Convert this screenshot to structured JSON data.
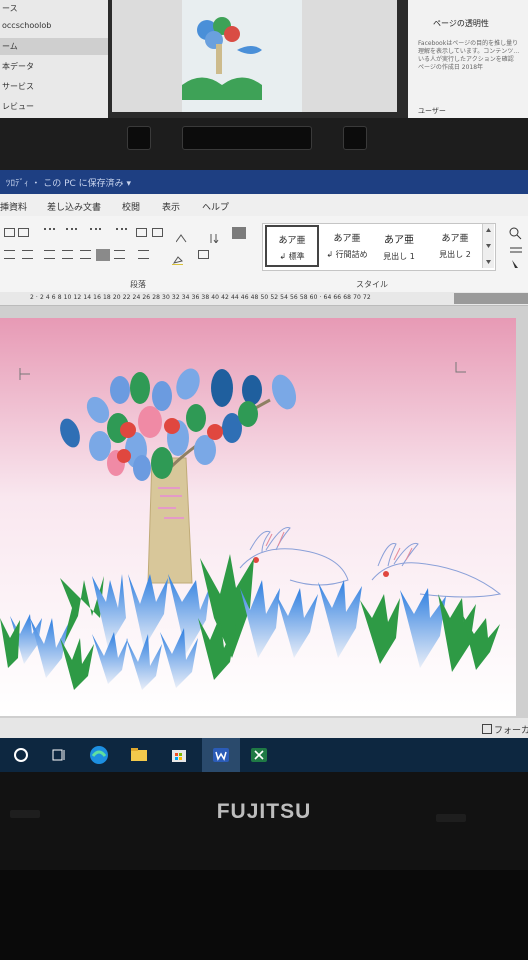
{
  "background_monitor": {
    "left_panel_items": [
      "ース",
      "occschoolob",
      "ーム",
      "本データ",
      "サービス",
      "レビュー"
    ],
    "facebook_title": "ページの透明性",
    "facebook_desc": "Facebookはページの目的を推し量り理解を表示しています。コンテンツ…いる人が実行したアクションを確認",
    "facebook_date": "ページの作成日 2018年",
    "facebook_user": "ユーザー"
  },
  "word": {
    "title": "ﾂﾛﾃﾞｨ ・ この PC に保存済み ▾",
    "tabs": [
      "差し込み文書",
      "校閲",
      "表示",
      "ヘルプ"
    ],
    "tab_left_partial": "挿資料",
    "groups": {
      "paragraph": "段落",
      "styles": "スタイル"
    },
    "styles": [
      {
        "preview": "あア亜",
        "name": "↲ 標準"
      },
      {
        "preview": "あア亜",
        "name": "↲ 行間詰め"
      },
      {
        "preview": "あア亜",
        "name": "見出し 1"
      },
      {
        "preview": "あア亜",
        "name": "見出し 2"
      }
    ],
    "ruler_numbers": "2 · 2 4 6 8 10 12 14 16 18 20 22 24 26 28 30 32 34 36 38 40 42 44 46 48 50 52 54 56 58 60 · 64 66 68 70 72",
    "status_right": "フォーカ"
  },
  "taskbar": {
    "icons": [
      "start-circle-icon",
      "task-view-icon",
      "edge-icon",
      "file-explorer-icon",
      "store-icon",
      "word-icon",
      "excel-icon"
    ]
  },
  "laptop": {
    "brand": "FUJITSU"
  },
  "colors": {
    "titlebar": "#1e3f82",
    "taskbar": "#0d2740",
    "page_gradient_top": "#e79ab5",
    "page_gradient_bottom": "#ffffff",
    "leaf_blue": "#5f8fd6",
    "leaf_green": "#2f9a55",
    "fruit_red": "#e0473f",
    "trunk": "#d8c79a",
    "grass_blue": "#3b8fe0",
    "grass_green": "#3aa14b"
  }
}
